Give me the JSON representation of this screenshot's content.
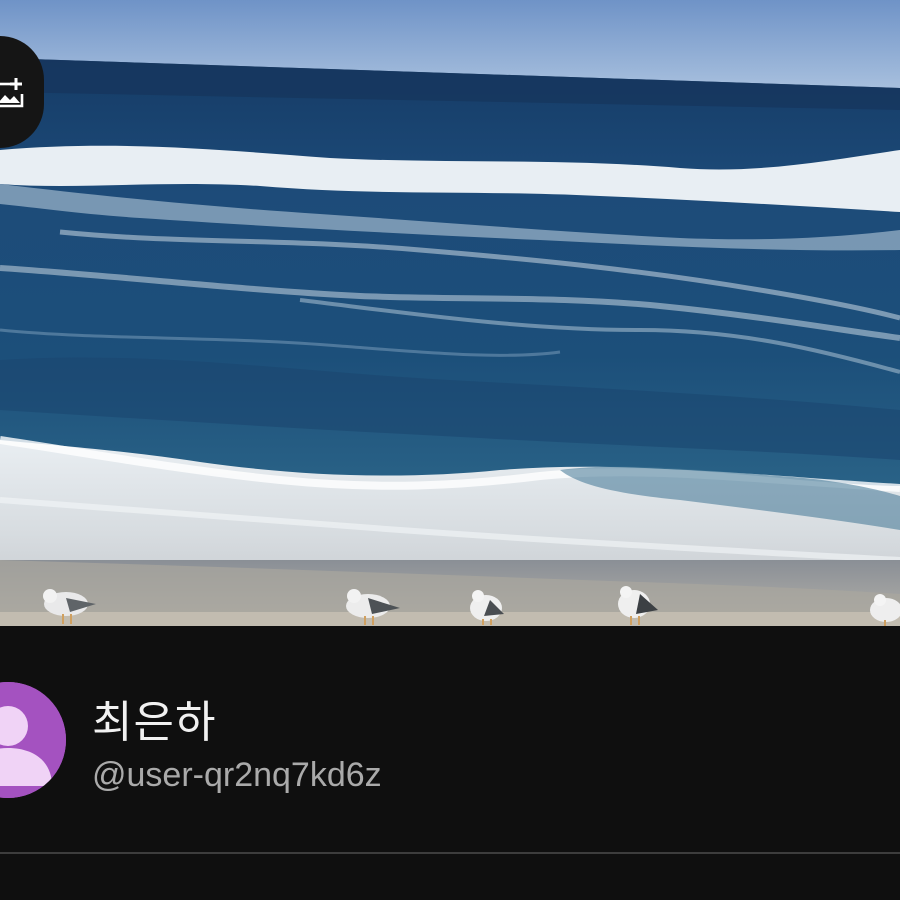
{
  "banner": {
    "image_description_icon": "ocean-banner-image",
    "edit_icon": "add-image-icon"
  },
  "channel": {
    "name": "최은하",
    "handle": "@user-qr2nq7kd6z",
    "avatar_icon": "default-person-avatar-icon",
    "avatar_color": "#a452c0"
  },
  "colors": {
    "background": "#0f0f0f",
    "name_text": "#f1f1f1",
    "handle_text": "#aaaaaa",
    "divider": "#3d3d3d"
  }
}
